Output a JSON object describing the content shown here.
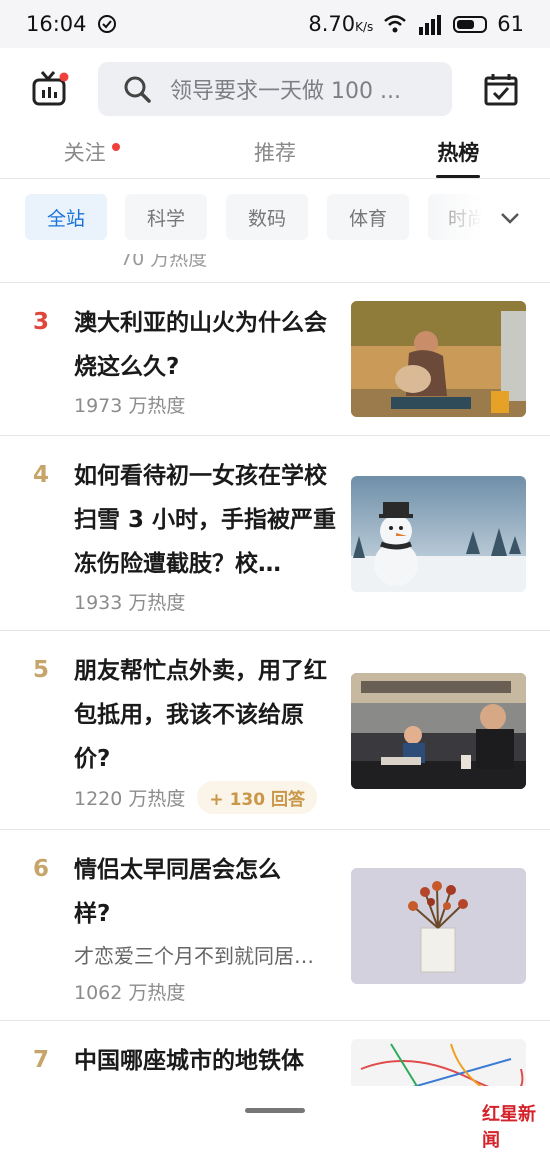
{
  "status": {
    "time": "16:04",
    "speed": "8.70",
    "speed_unit": "K/s",
    "network": "4G",
    "battery": "61"
  },
  "header": {
    "search_placeholder": "领导要求一天做 100 ..."
  },
  "tabs": [
    {
      "label": "关注",
      "dot": true
    },
    {
      "label": "推荐"
    },
    {
      "label": "热榜",
      "active": true
    }
  ],
  "filters": [
    "全站",
    "科学",
    "数码",
    "体育",
    "时尚"
  ],
  "partial_heat": "70 万热度",
  "items": [
    {
      "rank": "3",
      "title": "澳大利亚的山火为什么会烧这么久?",
      "heat": "1973 万热度",
      "image": "bushfire-photo"
    },
    {
      "rank": "4",
      "title": "如何看待初一女孩在学校扫雪 3 小时，手指被严重冻伤险遭截肢？校…",
      "heat": "1933 万热度",
      "image": "snowman-photo"
    },
    {
      "rank": "5",
      "title": "朋友帮忙点外卖，用了红包抵用，我该不该给原价?",
      "heat": "1220 万热度",
      "badge": "+ 130 回答",
      "image": "restaurant-photo"
    },
    {
      "rank": "6",
      "title": "情侣太早同居会怎么样?",
      "excerpt": "才恋爱三个月不到就同居…",
      "heat": "1062 万热度",
      "image": "flowers-photo"
    },
    {
      "rank": "7",
      "title": "中国哪座城市的地铁体",
      "image": "subway-map"
    }
  ],
  "watermark": "红星新闻",
  "colors": {
    "accent_blue": "#1a73d9",
    "rank_top": "#e0453c",
    "rank_gold": "#c6a46a",
    "dot_red": "#f1403c"
  }
}
